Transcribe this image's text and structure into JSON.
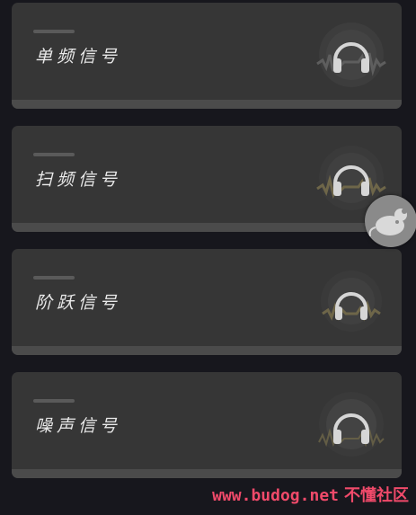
{
  "signals": [
    {
      "label": "单频信号",
      "wave_color": "#5e5e5e"
    },
    {
      "label": "扫频信号",
      "wave_color": "#6e6649"
    },
    {
      "label": "阶跃信号",
      "wave_color": "#6e6649"
    },
    {
      "label": "噪声信号",
      "wave_color": "#6e6649"
    }
  ],
  "icons": {
    "card": "headphones-icon",
    "floating": "mouse-icon"
  },
  "watermark": {
    "url": "www.budog.net",
    "text": "不懂社区"
  },
  "colors": {
    "background": "#17171d",
    "card": "#363636",
    "card_strip": "#4b4b4b",
    "watermark": "#f04a6a"
  }
}
